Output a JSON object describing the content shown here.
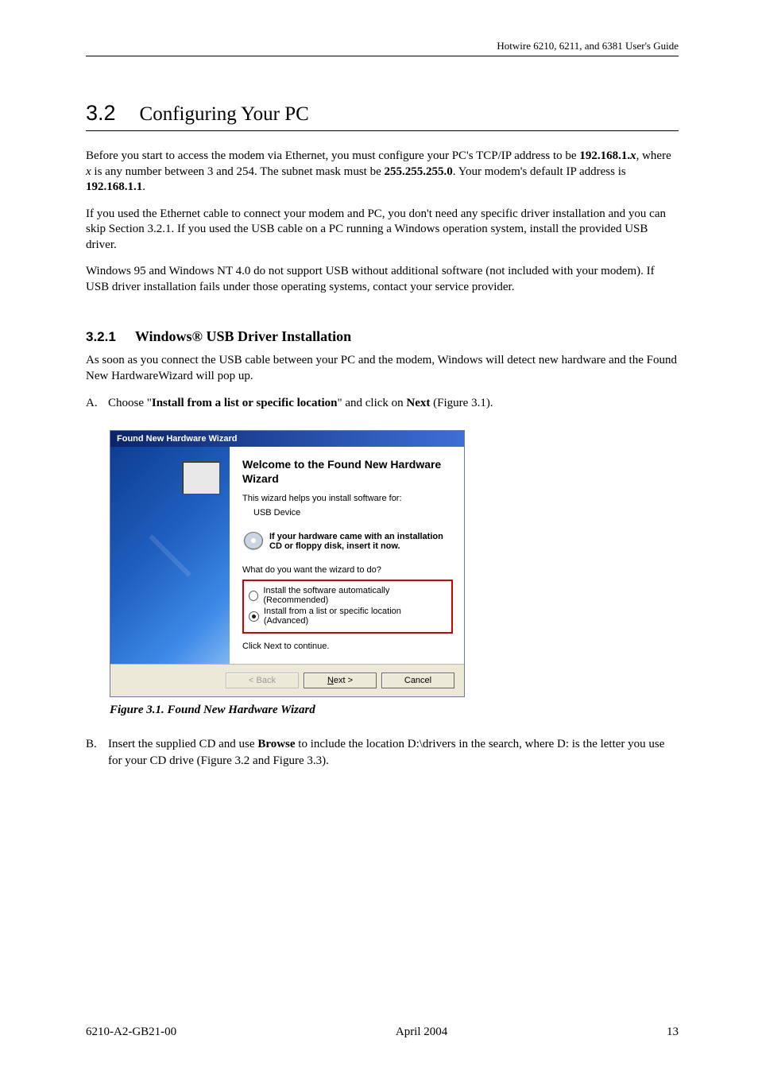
{
  "header": {
    "running_head": "Hotwire 6210, 6211, and 6381 User's Guide"
  },
  "section": {
    "num": "3.2",
    "title": "Configuring Your PC"
  },
  "para1": {
    "t1": "Before you start to access the modem via Ethernet, you must configure your PC's TCP/IP address to be ",
    "b1": "192.168.1.",
    "bi1": "x",
    "t2": ", where ",
    "i1": "x",
    "t3": " is any number between 3 and 254. The subnet mask must be ",
    "b2": "255.255.255.0",
    "t4": ". Your modem's default IP address is ",
    "b3": "192.168.1.1",
    "t5": "."
  },
  "para2": "If you used the Ethernet cable to connect your modem and PC, you don't need any specific driver installation and you can skip Section 3.2.1. If you used the USB cable on a PC running a Windows operation system, install the provided USB driver.",
  "para3": "Windows 95 and Windows NT 4.0 do not support USB without additional software (not included with your modem). If USB driver installation fails under those operating systems, contact your service provider.",
  "subsection": {
    "num": "3.2.1",
    "title": "Windows® USB Driver Installation"
  },
  "para4": "As soon as you connect the USB cable between your PC and the modem, Windows will detect new hardware and the Found New HardwareWizard will pop up.",
  "stepA": {
    "marker": "A.",
    "t1": "Choose \"",
    "b1": "Install from a list or specific location",
    "t2": "\" and click on ",
    "b2": "Next",
    "t3": " (Figure 3.1)."
  },
  "wizard": {
    "titlebar": "Found New Hardware Wizard",
    "heading": "Welcome to the Found New Hardware Wizard",
    "helps": "This wizard helps you install software for:",
    "device": "USB Device",
    "hint": "If your hardware came with an installation CD or floppy disk, insert it now.",
    "prompt": "What do you want the wizard to do?",
    "opt1": "Install the software automatically (Recommended)",
    "opt2": "Install from a list or specific location (Advanced)",
    "continue": "Click Next to continue.",
    "btn_back": "< Back",
    "btn_next_pre": "N",
    "btn_next_suf": "ext >",
    "btn_cancel": "Cancel"
  },
  "caption1": "Figure 3.1. Found New Hardware Wizard",
  "stepB": {
    "marker": "B.",
    "t1": "Insert the supplied CD and use ",
    "b1": "Browse",
    "t2": " to include the location D:\\drivers in the search, where D: is the letter you use for your CD drive (Figure 3.2 and Figure 3.3)."
  },
  "footer": {
    "left": "6210-A2-GB21-00",
    "center": "April 2004",
    "right": "13"
  }
}
